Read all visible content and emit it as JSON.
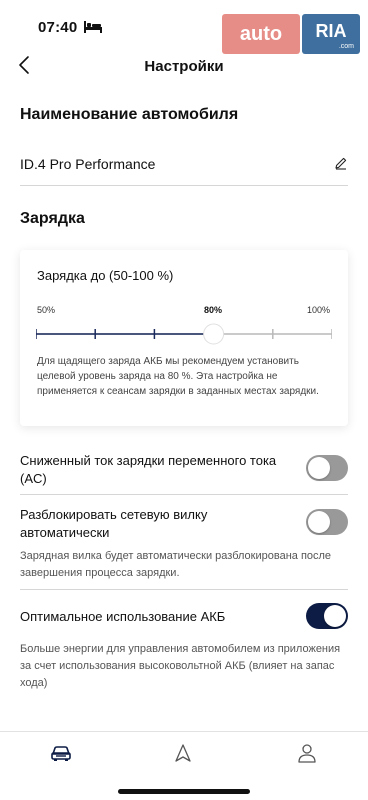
{
  "status_bar": {
    "time": "07:40"
  },
  "watermark": {
    "auto": "auto",
    "ria": "RIA",
    "ria_sub": ".com"
  },
  "header": {
    "title": "Настройки"
  },
  "vehicle_name": {
    "section_title": "Наименование автомобиля",
    "value": "ID.4 Pro Performance"
  },
  "charging": {
    "section_title": "Зарядка",
    "card_title": "Зарядка до (50-100 %)",
    "ticks": [
      "50%",
      "80%",
      "100%"
    ],
    "min": 50,
    "max": 100,
    "value": 80,
    "note": "Для щадящего заряда АКБ мы рекомендуем установить целевой уровень заряда на 80 %. Эта настройка не применяется к сеансам зарядки в заданных местах зарядки."
  },
  "settings": [
    {
      "label": "Сниженный ток зарядки переменного тока (AC)",
      "enabled": false
    },
    {
      "label": "Разблокировать сетевую вилку автоматически",
      "enabled": false,
      "helper": "Зарядная вилка будет автоматически разблокирована после завершения процесса зарядки."
    },
    {
      "label": "Оптимальное использование АКБ",
      "enabled": true,
      "helper": "Больше энергии для управления автомобилем из приложения за счет использования высоковольтной АКБ (влияет на запас хода)"
    }
  ],
  "colors": {
    "accent": "#0d1c45",
    "toggle_off": "#999999",
    "slider_active": "#1a2a5c",
    "slider_inactive": "#b9b9b9"
  },
  "tab_bar": {
    "icons": [
      "car-icon",
      "navigation-arrow-icon",
      "profile-icon"
    ]
  }
}
